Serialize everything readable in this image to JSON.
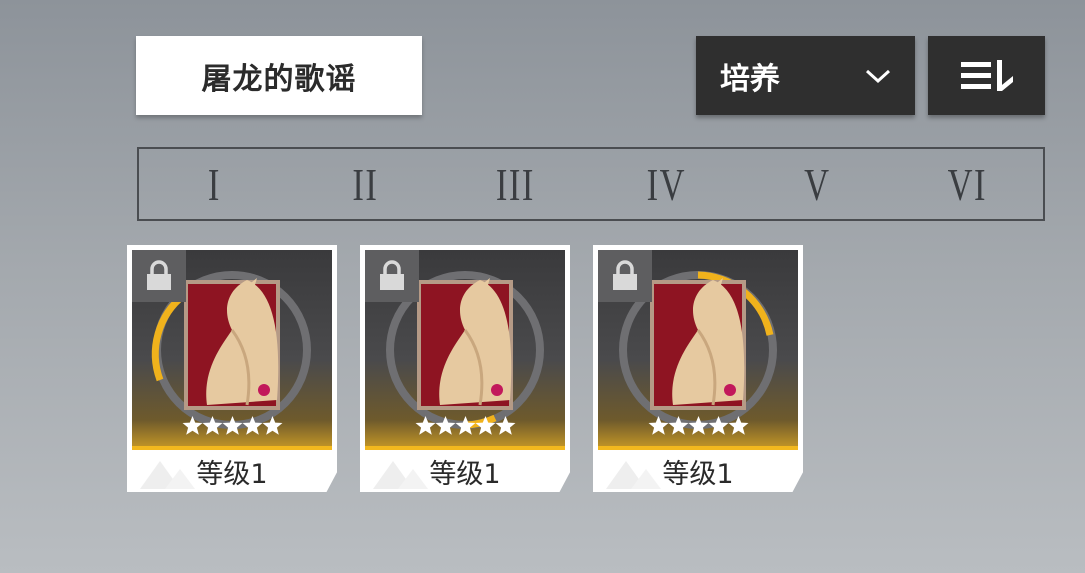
{
  "header": {
    "title": "屠龙的歌谣",
    "filter_label": "培养",
    "filter_icon": "chevron-down-icon",
    "sort_icon": "sort-icon"
  },
  "tabs": [
    "I",
    "II",
    "III",
    "IV",
    "V",
    "VI"
  ],
  "cards": [
    {
      "level_label": "等级1",
      "stars": 5,
      "locked": true
    },
    {
      "level_label": "等级1",
      "stars": 5,
      "locked": true
    },
    {
      "level_label": "等级1",
      "stars": 5,
      "locked": true
    }
  ],
  "colors": {
    "panel_dark": "#2f2f2f",
    "accent_gold": "#f2b81e",
    "dragon_red": "#8e1422",
    "dragon_gold": "#e6c9a0"
  }
}
